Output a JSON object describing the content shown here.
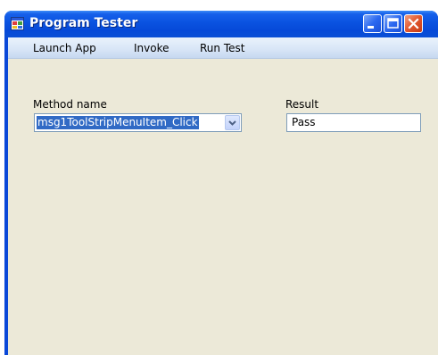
{
  "window": {
    "title": "Program Tester",
    "icons": {
      "app": "window-app-icon",
      "minimize": "minimize-icon",
      "maximize": "maximize-icon",
      "close": "close-icon"
    },
    "colors": {
      "titlebar": "#0a52e0",
      "client_bg": "#ece9d8",
      "selection": "#316ac5",
      "close_button": "#e1562e"
    }
  },
  "menu": {
    "items": [
      {
        "label": "Launch App"
      },
      {
        "label": "Invoke"
      },
      {
        "label": "Run Test"
      }
    ]
  },
  "form": {
    "method_label": "Method name",
    "method_value": "msg1ToolStripMenuItem_Click",
    "dropdown_icon": "chevron-down-icon",
    "result_label": "Result",
    "result_value": "Pass"
  }
}
